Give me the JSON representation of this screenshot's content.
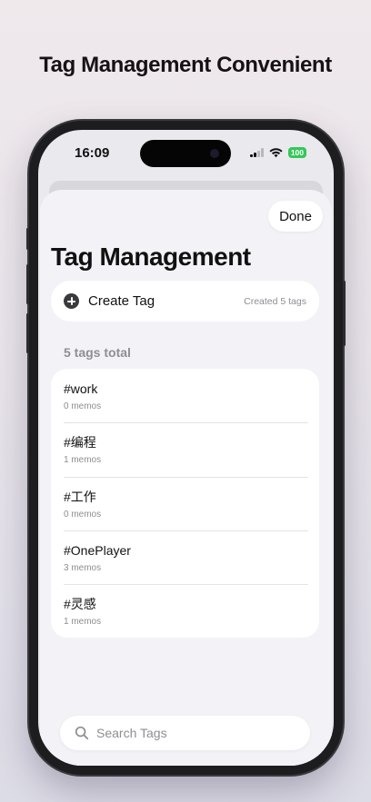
{
  "headline": "Tag Management Convenient",
  "status": {
    "time": "16:09",
    "battery": "100",
    "battery_color": "#34c759"
  },
  "icons": {
    "signal": "cellular-signal-icon",
    "wifi": "wifi-icon",
    "battery": "battery-icon",
    "plus": "plus-circle-icon",
    "search": "magnifying-glass-icon"
  },
  "sheet": {
    "done_label": "Done",
    "title": "Tag Management",
    "create_label": "Create Tag",
    "created_count": "Created 5 tags",
    "section_header": "5 tags total",
    "tags": [
      {
        "name": "#work",
        "count": "0 memos"
      },
      {
        "name": "#编程",
        "count": "1 memos"
      },
      {
        "name": "#工作",
        "count": "0 memos"
      },
      {
        "name": "#OnePlayer",
        "count": "3 memos"
      },
      {
        "name": "#灵感",
        "count": "1 memos"
      }
    ],
    "search_placeholder": "Search Tags"
  }
}
